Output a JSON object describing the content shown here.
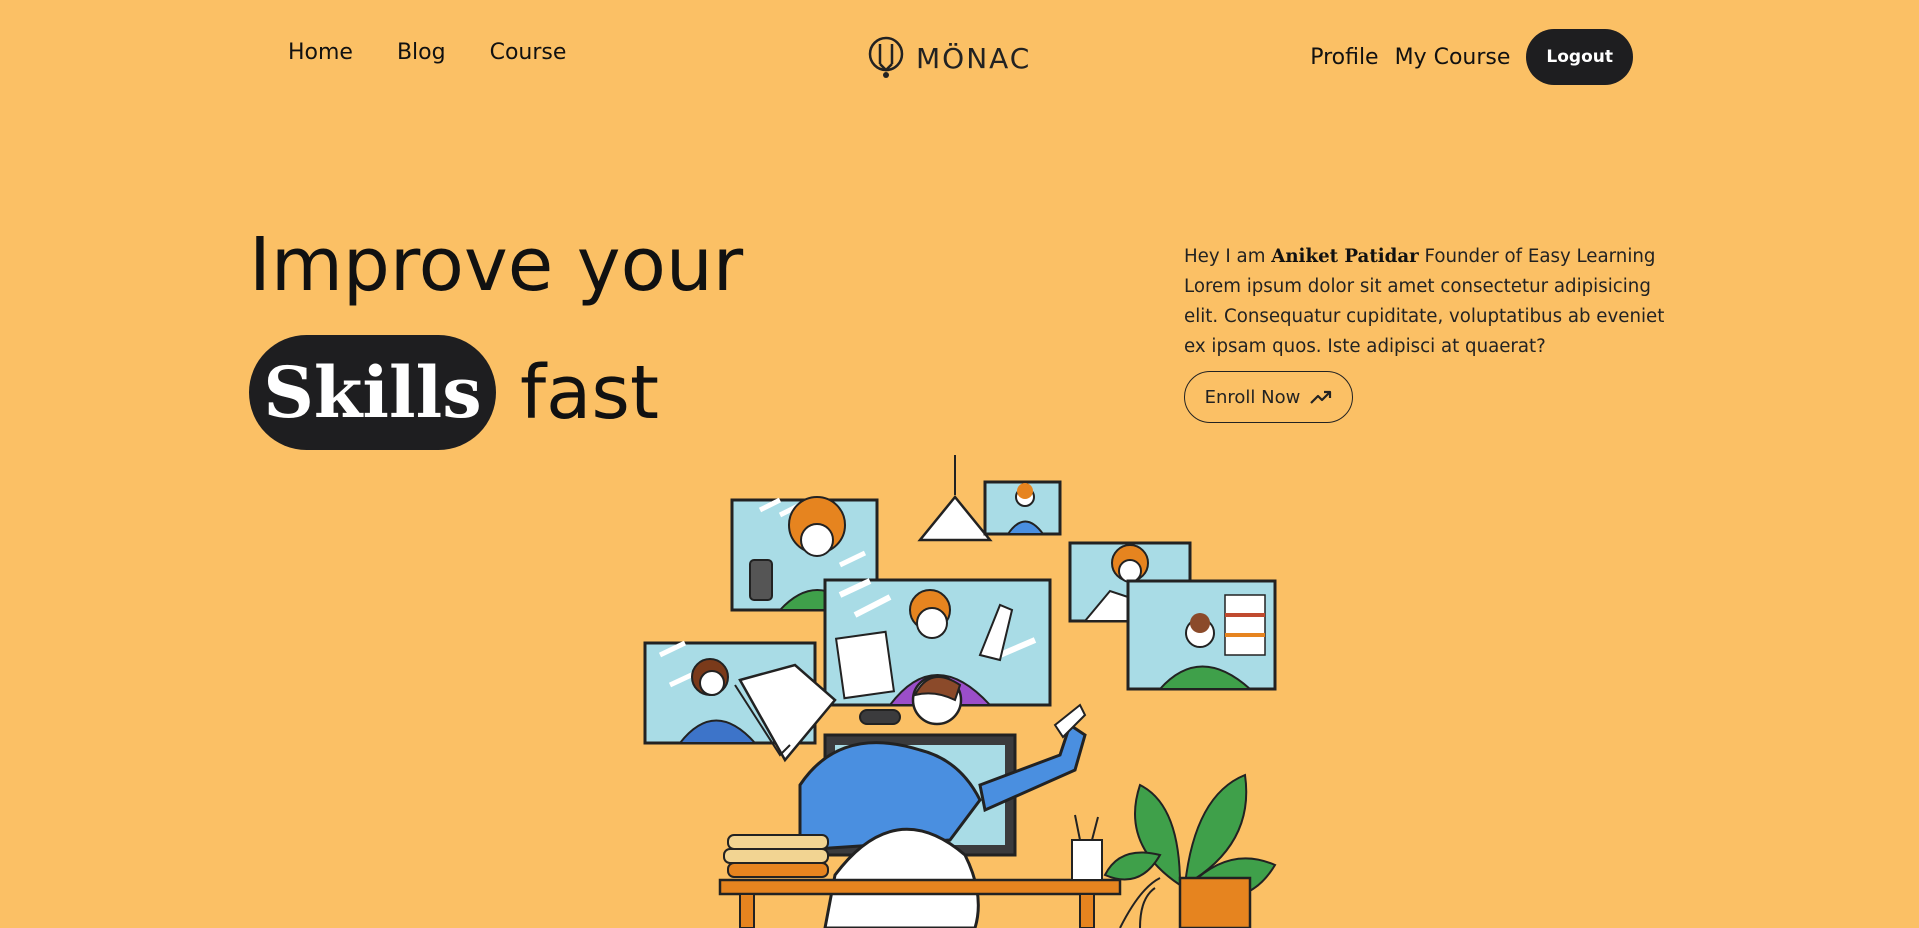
{
  "nav": {
    "links_left": [
      "Home",
      "Blog",
      "Course"
    ],
    "brand": "MÖNAC",
    "links_right": [
      "Profile",
      "My Course"
    ],
    "logout_label": "Logout"
  },
  "hero": {
    "headline_line1": "Improve your",
    "headline_highlight": "Skills",
    "headline_tail": "fast",
    "intro_prefix": "Hey I am",
    "intro_name": "Aniket Patidar",
    "intro_suffix": "Founder of Easy Learning Lorem ipsum dolor sit amet consectetur adipisicing elit. Consequatur cupiditate, voluptatibus ab eveniet ex ipsam quos. Iste adipisci at quaerat?",
    "cta_label": "Enroll Now"
  },
  "icons": {
    "cta_icon": "trending-up-icon",
    "logo_icon": "lightbulb-logo-icon"
  },
  "colors": {
    "background": "#fbc065",
    "dark": "#1e1e20"
  }
}
